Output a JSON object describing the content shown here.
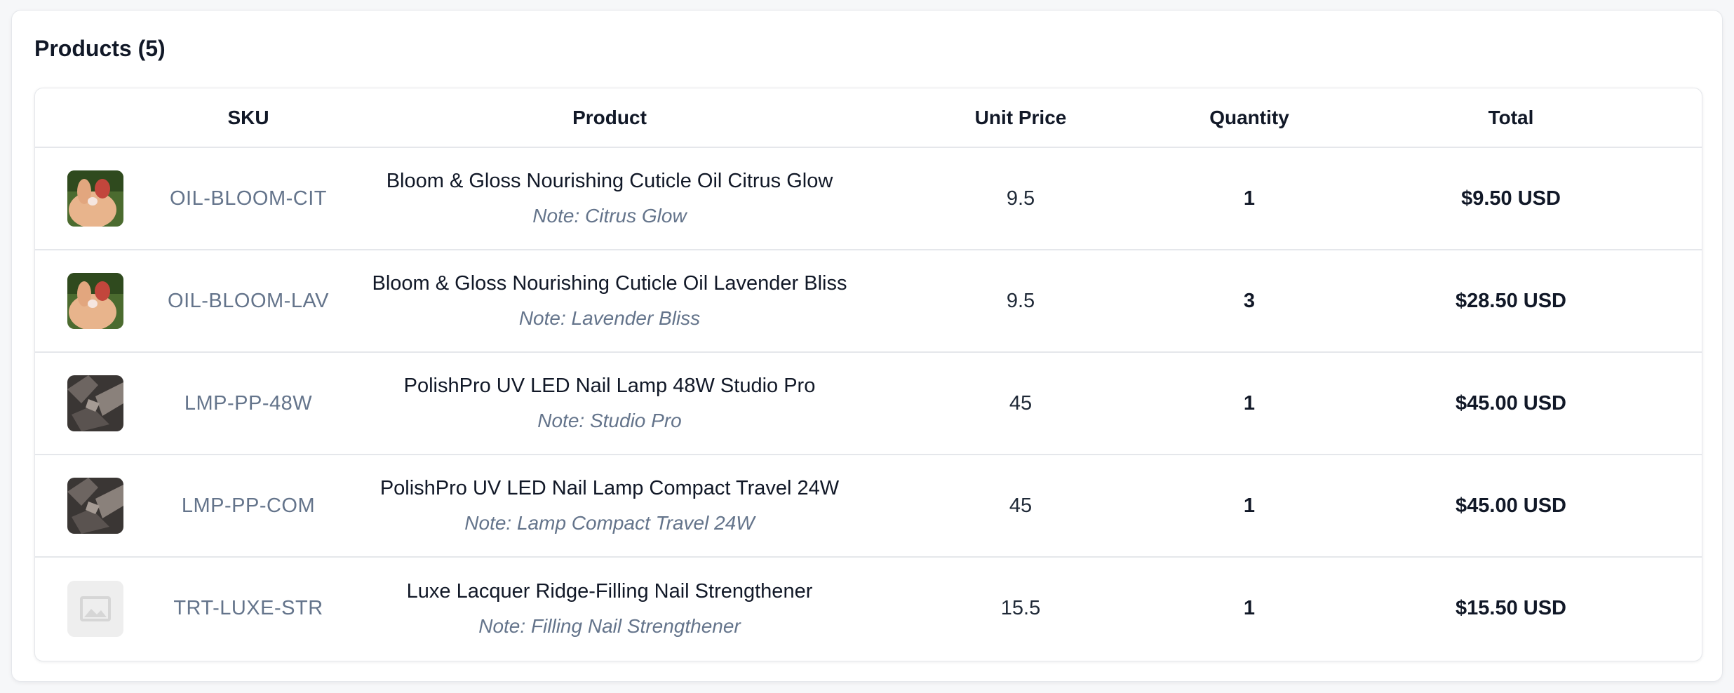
{
  "section": {
    "title": "Products (5)"
  },
  "table": {
    "headers": {
      "image": "",
      "sku": "SKU",
      "product": "Product",
      "unit_price": "Unit Price",
      "quantity": "Quantity",
      "total": "Total"
    },
    "rows": [
      {
        "image": "hand-nail-photo",
        "sku": "OIL-BLOOM-CIT",
        "product": "Bloom & Gloss Nourishing Cuticle Oil Citrus Glow",
        "note": "Note: Citrus Glow",
        "unit_price": "9.5",
        "quantity": "1",
        "total": "$9.50 USD"
      },
      {
        "image": "hand-nail-photo",
        "sku": "OIL-BLOOM-LAV",
        "product": "Bloom & Gloss Nourishing Cuticle Oil Lavender Bliss",
        "note": "Note: Lavender Bliss",
        "unit_price": "9.5",
        "quantity": "3",
        "total": "$28.50 USD"
      },
      {
        "image": "nail-lamp-photo",
        "sku": "LMP-PP-48W",
        "product": "PolishPro UV LED Nail Lamp 48W Studio Pro",
        "note": "Note: Studio Pro",
        "unit_price": "45",
        "quantity": "1",
        "total": "$45.00 USD"
      },
      {
        "image": "nail-lamp-photo",
        "sku": "LMP-PP-COM",
        "product": "PolishPro UV LED Nail Lamp Compact Travel 24W",
        "note": "Note: Lamp Compact Travel 24W",
        "unit_price": "45",
        "quantity": "1",
        "total": "$45.00 USD"
      },
      {
        "image": "image-placeholder-icon",
        "sku": "TRT-LUXE-STR",
        "product": "Luxe Lacquer Ridge-Filling Nail Strengthener",
        "note": "Note: Filling Nail Strengthener",
        "unit_price": "15.5",
        "quantity": "1",
        "total": "$15.50 USD"
      }
    ]
  },
  "colors": {
    "text_primary": "#111827",
    "text_muted": "#64748b",
    "border": "#e5e7eb",
    "placeholder_bg": "#eeeeee"
  }
}
